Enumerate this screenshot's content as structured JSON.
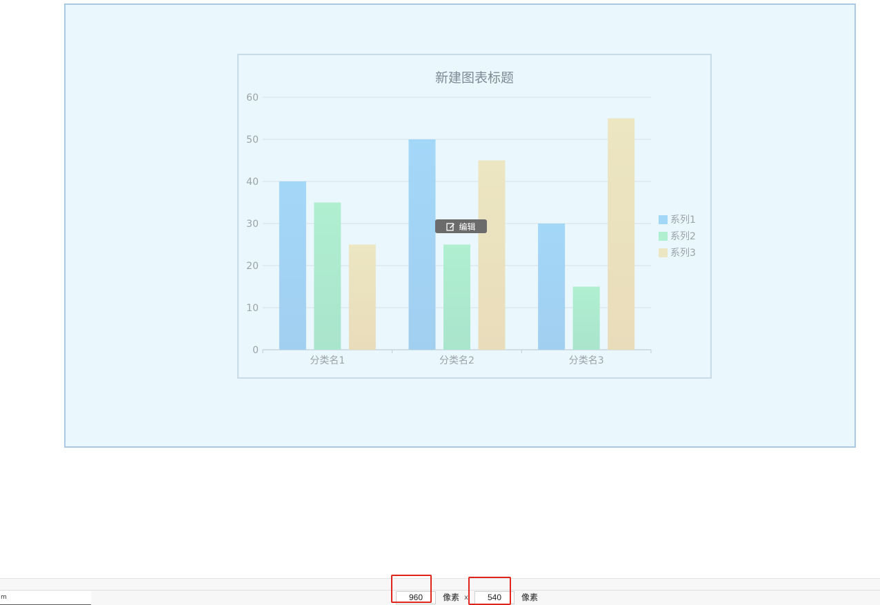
{
  "chart_data": {
    "type": "bar",
    "title": "新建图表标题",
    "categories": [
      "分类名1",
      "分类名2",
      "分类名3"
    ],
    "series": [
      {
        "name": "系列1",
        "values": [
          40,
          50,
          30
        ],
        "color": "#a3d7f8"
      },
      {
        "name": "系列2",
        "values": [
          35,
          25,
          15
        ],
        "color": "#b0efd0"
      },
      {
        "name": "系列3",
        "values": [
          25,
          45,
          55
        ],
        "color": "#ece6c2"
      }
    ],
    "ylim": [
      0,
      60
    ],
    "yticks": [
      0,
      10,
      20,
      30,
      40,
      50,
      60
    ],
    "grid": true,
    "legend": "right"
  },
  "edit_badge": {
    "label": "编辑",
    "icon": "edit-icon"
  },
  "bottom_bar": {
    "width_value": "960",
    "height_value": "540",
    "unit_label": "像素",
    "separator": "x",
    "left_stub_text": "m"
  },
  "colors": {
    "canvas_bg": "#eaf7fd",
    "canvas_border": "#a9c9e6",
    "highlight": "#e0241c"
  }
}
